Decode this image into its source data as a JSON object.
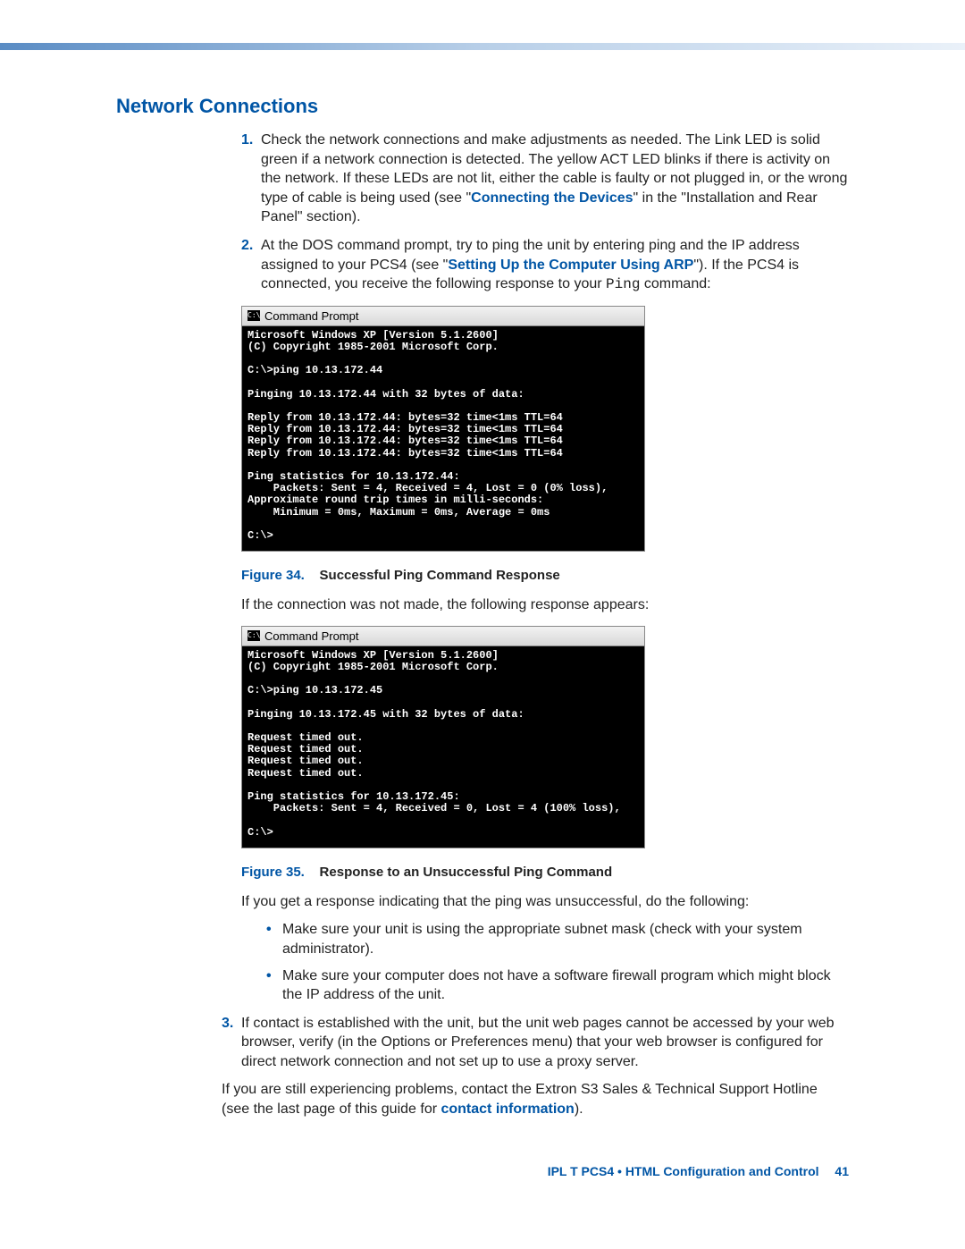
{
  "section_title": "Network Connections",
  "steps": {
    "1": {
      "num": "1.",
      "text_before": "Check the network connections and make adjustments as needed. The Link LED is solid green if a network connection is detected. The yellow ACT LED blinks if there is activity on the network. If these LEDs are not lit, either the cable is faulty or not plugged in, or the wrong type of cable is being used (see \"",
      "link": "Connecting the Devices",
      "text_after": "\" in the \"Installation and Rear Panel\" section)."
    },
    "2": {
      "num": "2.",
      "text_before": "At the DOS command prompt, try to ping the unit by entering ping and the IP address assigned to your PCS4 (see \"",
      "link": "Setting Up the Computer Using ARP",
      "text_after": "\"). If the PCS4 is connected, you receive the following response to your ",
      "mono": "Ping",
      "text_end": " command:"
    },
    "3": {
      "num": "3.",
      "text": "If contact is established with the unit, but the unit web pages cannot be accessed by your web browser, verify (in the Options or Preferences menu) that your web browser is configured for direct network connection and not set up to use a proxy server."
    }
  },
  "cmd1": {
    "title": "Command Prompt",
    "body": "Microsoft Windows XP [Version 5.1.2600]\n(C) Copyright 1985-2001 Microsoft Corp.\n\nC:\\>ping 10.13.172.44\n\nPinging 10.13.172.44 with 32 bytes of data:\n\nReply from 10.13.172.44: bytes=32 time<1ms TTL=64\nReply from 10.13.172.44: bytes=32 time<1ms TTL=64\nReply from 10.13.172.44: bytes=32 time<1ms TTL=64\nReply from 10.13.172.44: bytes=32 time<1ms TTL=64\n\nPing statistics for 10.13.172.44:\n    Packets: Sent = 4, Received = 4, Lost = 0 (0% loss),\nApproximate round trip times in milli-seconds:\n    Minimum = 0ms, Maximum = 0ms, Average = 0ms\n\nC:\\>"
  },
  "fig34": {
    "label": "Figure 34.",
    "title": "Successful Ping Command Response"
  },
  "para_after_fig34": "If the connection was not made, the following response appears:",
  "cmd2": {
    "title": "Command Prompt",
    "body": "Microsoft Windows XP [Version 5.1.2600]\n(C) Copyright 1985-2001 Microsoft Corp.\n\nC:\\>ping 10.13.172.45\n\nPinging 10.13.172.45 with 32 bytes of data:\n\nRequest timed out.\nRequest timed out.\nRequest timed out.\nRequest timed out.\n\nPing statistics for 10.13.172.45:\n    Packets: Sent = 4, Received = 0, Lost = 4 (100% loss),\n\nC:\\>"
  },
  "fig35": {
    "label": "Figure 35.",
    "title": "Response to an Unsuccessful Ping Command"
  },
  "para_after_fig35": "If you get a response indicating that the ping was unsuccessful, do the following:",
  "bullets": [
    "Make sure your unit is using the appropriate subnet mask (check with your system administrator).",
    "Make sure your computer does not have a software firewall program which might block the IP address of the unit."
  ],
  "closing": {
    "text_before": "If you are still experiencing problems, contact the Extron S3 Sales & Technical Support Hotline (see the last page of this guide for ",
    "link": "contact information",
    "text_after": ")."
  },
  "footer": {
    "text": "IPL T PCS4 • HTML Configuration and Control",
    "page": "41"
  }
}
